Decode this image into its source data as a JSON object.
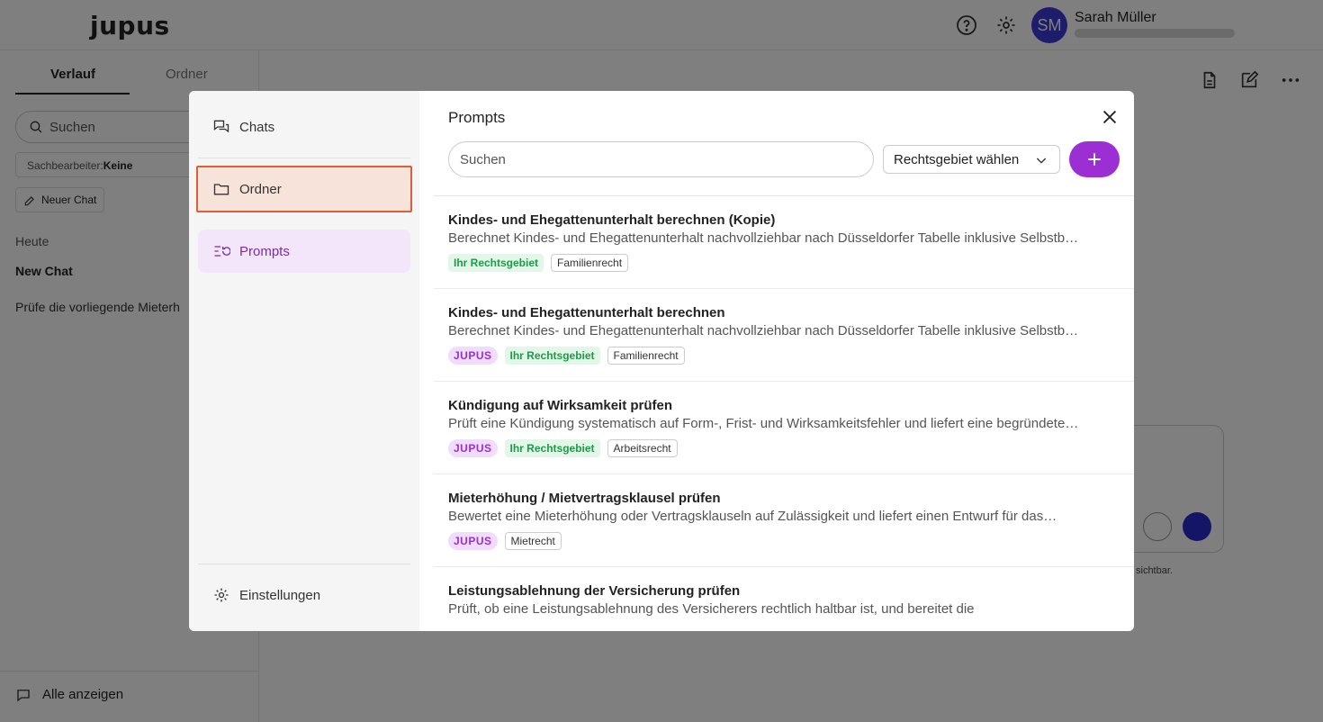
{
  "app": {
    "logo": "jupus",
    "user": {
      "initials": "SM",
      "name": "Sarah Müller"
    }
  },
  "sidebar": {
    "tabs": [
      "Verlauf",
      "Ordner"
    ],
    "search_placeholder": "Suchen",
    "clerk_label": "Sachbearbeiter:",
    "clerk_value": "Keine",
    "new_chat_label": "Neuer Chat",
    "group_label": "Heute",
    "chats": [
      "New Chat",
      "Prüfe die vorliegende Mieterh"
    ],
    "show_all_label": "Alle anzeigen"
  },
  "main": {
    "hint_text": "sichtbar."
  },
  "modal": {
    "nav": {
      "chats": "Chats",
      "folder": "Ordner",
      "prompts": "Prompts",
      "settings": "Einstellungen"
    },
    "title": "Prompts",
    "search_placeholder": "Suchen",
    "area_select_label": "Rechtsgebiet wählen",
    "prompts": [
      {
        "title": "Kindes- und Ehegattenunterhalt berechnen (Kopie)",
        "description": "Berechnet Kindes- und Ehegattenunterhalt nachvollziehbar nach Düsseldorfer Tabelle inklusive Selbstbehalt und Mangelfallberechnung",
        "tags": [
          {
            "label": "Ihr Rechtsgebiet",
            "kind": "area"
          },
          {
            "label": "Familienrecht",
            "kind": "cat"
          }
        ]
      },
      {
        "title": "Kindes- und Ehegattenunterhalt berechnen",
        "description": "Berechnet Kindes- und Ehegattenunterhalt nachvollziehbar nach Düsseldorfer Tabelle inklusive Selbstbehalt und Mangelfallberechnung",
        "tags": [
          {
            "label": "JUPUS",
            "kind": "jupus"
          },
          {
            "label": "Ihr Rechtsgebiet",
            "kind": "area"
          },
          {
            "label": "Familienrecht",
            "kind": "cat"
          }
        ]
      },
      {
        "title": "Kündigung auf Wirksamkeit prüfen",
        "description": "Prüft eine Kündigung systematisch auf Form-, Frist- und Wirksamkeitsfehler und liefert eine begründete…",
        "tags": [
          {
            "label": "JUPUS",
            "kind": "jupus"
          },
          {
            "label": "Ihr Rechtsgebiet",
            "kind": "area"
          },
          {
            "label": "Arbeitsrecht",
            "kind": "cat"
          }
        ]
      },
      {
        "title": "Mieterhöhung / Mietvertragsklausel prüfen",
        "description": "Bewertet eine Mieterhöhung oder Vertragsklauseln auf Zulässigkeit und liefert einen Entwurf für das…",
        "tags": [
          {
            "label": "JUPUS",
            "kind": "jupus"
          },
          {
            "label": "Mietrecht",
            "kind": "cat"
          }
        ]
      },
      {
        "title": "Leistungsablehnung der Versicherung prüfen",
        "description": "Prüft, ob eine Leistungsablehnung des Versicherers rechtlich haltbar ist, und bereitet die",
        "tags": []
      }
    ]
  },
  "colors": {
    "accent": "#9b2fd4",
    "folder_highlight_border": "#d9603a",
    "area_tag": "#1f9a4a"
  }
}
